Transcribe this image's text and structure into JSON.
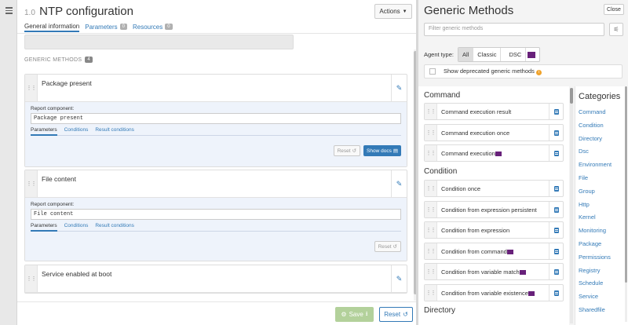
{
  "header": {
    "version": "1.0",
    "title": "NTP configuration",
    "actions_label": "Actions"
  },
  "tabs": [
    {
      "label": "General information"
    },
    {
      "label": "Parameters",
      "badge": "0"
    },
    {
      "label": "Resources",
      "badge": "0"
    }
  ],
  "section": {
    "title": "GENERIC METHODS",
    "count": "4"
  },
  "methods": [
    {
      "name": "Package present",
      "component_label": "Report component:",
      "component_value": "Package present"
    },
    {
      "name": "File content",
      "component_label": "Report component:",
      "component_value": "File content"
    },
    {
      "name": "Service enabled at boot"
    }
  ],
  "subtabs": {
    "parameters": "Parameters",
    "conditions": "Conditions",
    "result_conditions": "Result conditions"
  },
  "buttons": {
    "reset_small": "Reset",
    "show_docs": "Show docs",
    "save": "Save",
    "reset": "Reset"
  },
  "panel": {
    "title": "Generic Methods",
    "close": "Close",
    "filter_placeholder": "Filter generic methods",
    "agent_type_label": "Agent type:",
    "agent_options": [
      "All",
      "Classic",
      "DSC"
    ],
    "deprecated_label": "Show deprecated generic methods",
    "categories_title": "Categories",
    "groups": [
      {
        "name": "Command",
        "items": [
          "Command execution result",
          "Command execution once",
          "Command execution"
        ]
      },
      {
        "name": "Condition",
        "items": [
          "Condition once",
          "Condition from expression persistent",
          "Condition from expression",
          "Condition from command",
          "Condition from variable match",
          "Condition from variable existence"
        ]
      },
      {
        "name": "Directory",
        "items": []
      }
    ],
    "categories": [
      "Command",
      "Condition",
      "Directory",
      "Dsc",
      "Environment",
      "File",
      "Group",
      "Http",
      "Kernel",
      "Monitoring",
      "Package",
      "Permissions",
      "Registry",
      "Schedule",
      "Service",
      "Sharedfile"
    ]
  },
  "colors": {
    "accent": "#337ab7",
    "save": "#b3d19b",
    "dsc": "#68217a",
    "warning": "#f0a32c"
  }
}
